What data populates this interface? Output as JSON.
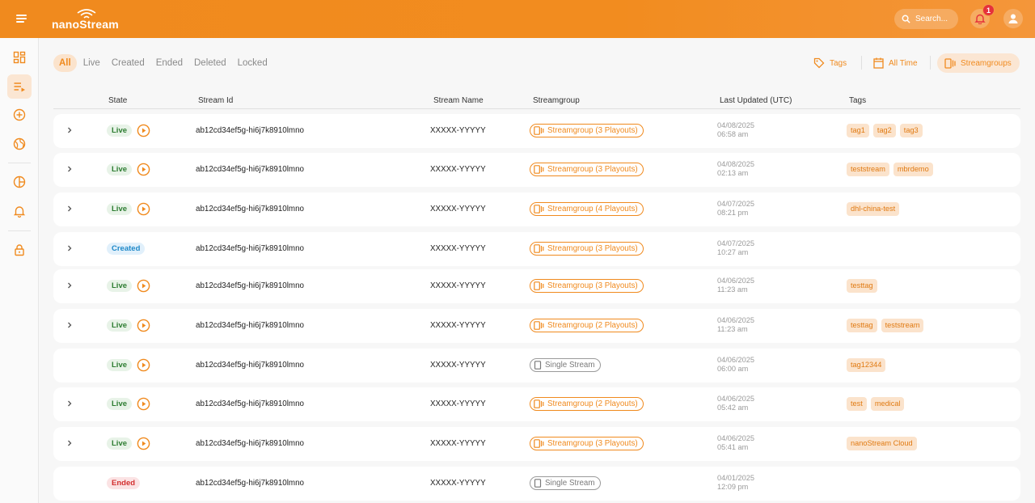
{
  "header": {
    "logo_text": "nanoStream",
    "search_placeholder": "Search...",
    "notification_count": "1",
    "brand_color": "#f08a1e"
  },
  "sidebar": {
    "items": [
      {
        "icon": "dashboard-icon"
      },
      {
        "icon": "stream-list-icon",
        "active": true
      },
      {
        "icon": "add-circle-icon"
      },
      {
        "icon": "globe-icon"
      },
      {
        "icon": "analytics-icon"
      },
      {
        "icon": "bell-icon"
      },
      {
        "icon": "lock-icon"
      }
    ]
  },
  "filters": {
    "tabs": [
      {
        "label": "All",
        "active": true
      },
      {
        "label": "Live"
      },
      {
        "label": "Created"
      },
      {
        "label": "Ended"
      },
      {
        "label": "Deleted"
      },
      {
        "label": "Locked"
      }
    ],
    "tags_label": "Tags",
    "time_label": "All Time",
    "streamgroups_label": "Streamgroups"
  },
  "table": {
    "columns": [
      "State",
      "Stream Id",
      "Stream Name",
      "Streamgroup",
      "Last Updated (UTC)",
      "Tags"
    ],
    "rows": [
      {
        "expandable": true,
        "state": "Live",
        "stream_id": "ab12cd34ef5g-hi6j7k8910lmno",
        "stream_name": "XXXXX-YYYYY",
        "streamgroup": "Streamgroup (3 Playouts)",
        "group_type": "group",
        "date": "04/08/2025",
        "time": "06:58 am",
        "tags": [
          "tag1",
          "tag2",
          "tag3"
        ]
      },
      {
        "expandable": true,
        "state": "Live",
        "stream_id": "ab12cd34ef5g-hi6j7k8910lmno",
        "stream_name": "XXXXX-YYYYY",
        "streamgroup": "Streamgroup (3 Playouts)",
        "group_type": "group",
        "date": "04/08/2025",
        "time": "02:13 am",
        "tags": [
          "teststream",
          "mbrdemo"
        ]
      },
      {
        "expandable": true,
        "state": "Live",
        "stream_id": "ab12cd34ef5g-hi6j7k8910lmno",
        "stream_name": "XXXXX-YYYYY",
        "streamgroup": "Streamgroup (4 Playouts)",
        "group_type": "group",
        "date": "04/07/2025",
        "time": "08:21 pm",
        "tags": [
          "dhl-china-test"
        ]
      },
      {
        "expandable": true,
        "state": "Created",
        "stream_id": "ab12cd34ef5g-hi6j7k8910lmno",
        "stream_name": "XXXXX-YYYYY",
        "streamgroup": "Streamgroup (3 Playouts)",
        "group_type": "group",
        "date": "04/07/2025",
        "time": "10:27 am",
        "tags": []
      },
      {
        "expandable": true,
        "state": "Live",
        "stream_id": "ab12cd34ef5g-hi6j7k8910lmno",
        "stream_name": "XXXXX-YYYYY",
        "streamgroup": "Streamgroup (3 Playouts)",
        "group_type": "group",
        "date": "04/06/2025",
        "time": "11:23 am",
        "tags": [
          "testtag"
        ]
      },
      {
        "expandable": true,
        "state": "Live",
        "stream_id": "ab12cd34ef5g-hi6j7k8910lmno",
        "stream_name": "XXXXX-YYYYY",
        "streamgroup": "Streamgroup (2 Playouts)",
        "group_type": "group",
        "date": "04/06/2025",
        "time": "11:23 am",
        "tags": [
          "testtag",
          "teststream"
        ]
      },
      {
        "expandable": false,
        "state": "Live",
        "stream_id": "ab12cd34ef5g-hi6j7k8910lmno",
        "stream_name": "XXXXX-YYYYY",
        "streamgroup": "Single Stream",
        "group_type": "single",
        "date": "04/06/2025",
        "time": "06:00 am",
        "tags": [
          "tag12344"
        ]
      },
      {
        "expandable": true,
        "state": "Live",
        "stream_id": "ab12cd34ef5g-hi6j7k8910lmno",
        "stream_name": "XXXXX-YYYYY",
        "streamgroup": "Streamgroup (2 Playouts)",
        "group_type": "group",
        "date": "04/06/2025",
        "time": "05:42 am",
        "tags": [
          "test",
          "medical"
        ]
      },
      {
        "expandable": true,
        "state": "Live",
        "stream_id": "ab12cd34ef5g-hi6j7k8910lmno",
        "stream_name": "XXXXX-YYYYY",
        "streamgroup": "Streamgroup (3 Playouts)",
        "group_type": "group",
        "date": "04/06/2025",
        "time": "05:41 am",
        "tags": [
          "nanoStream Cloud"
        ]
      },
      {
        "expandable": false,
        "state": "Ended",
        "stream_id": "ab12cd34ef5g-hi6j7k8910lmno",
        "stream_name": "XXXXX-YYYYY",
        "streamgroup": "Single Stream",
        "group_type": "single",
        "date": "04/01/2025",
        "time": "12:09 pm",
        "tags": []
      }
    ]
  }
}
